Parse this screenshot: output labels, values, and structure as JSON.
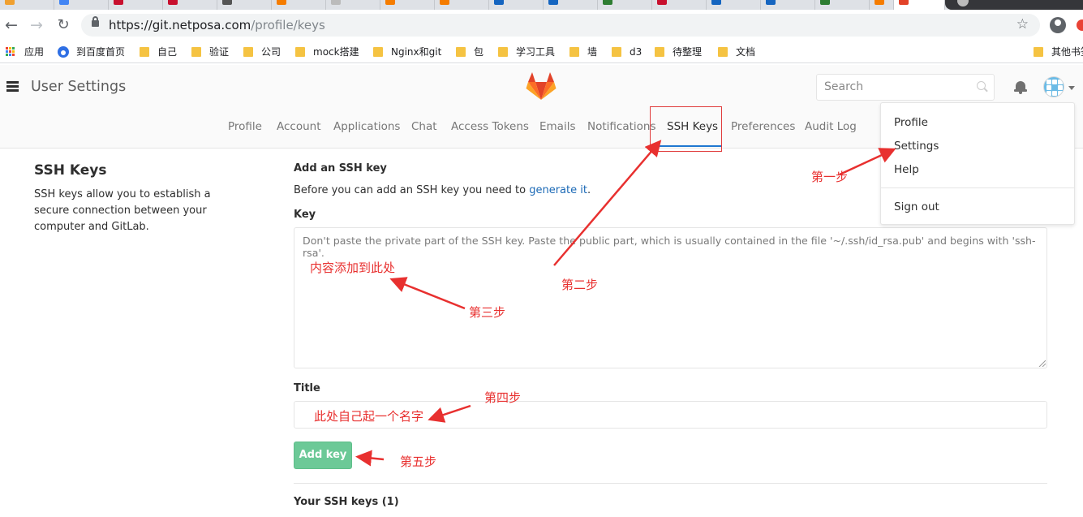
{
  "browser": {
    "url_host": "https://git.netposa.com",
    "url_path": "/profile/keys",
    "bookmarks": [
      "应用",
      "到百度首页",
      "自己",
      "验证",
      "公司",
      "mock搭建",
      "Nginx和git",
      "包",
      "学习工具",
      "墙",
      "d3",
      "待整理",
      "文档",
      "其他书签"
    ]
  },
  "header": {
    "title": "User Settings",
    "search_placeholder": "Search"
  },
  "nav": {
    "tabs": [
      "Profile",
      "Account",
      "Applications",
      "Chat",
      "Access Tokens",
      "Emails",
      "Notifications",
      "SSH Keys",
      "Preferences",
      "Audit Log"
    ],
    "active": "SSH Keys"
  },
  "sidebar": {
    "heading": "SSH Keys",
    "description": "SSH keys allow you to establish a secure connection between your computer and GitLab."
  },
  "form": {
    "section_title": "Add an SSH key",
    "intro_text": "Before you can add an SSH key you need to ",
    "intro_link": "generate it",
    "intro_end": ".",
    "key_label": "Key",
    "key_placeholder": "Don't paste the private part of the SSH key. Paste the public part, which is usually contained in the file '~/.ssh/id_rsa.pub' and begins with 'ssh-rsa'.",
    "title_label": "Title",
    "add_button": "Add key",
    "your_keys": "Your SSH keys (1)"
  },
  "dropdown": {
    "items": [
      "Profile",
      "Settings",
      "Help",
      "Sign out"
    ]
  },
  "annotations": {
    "step1": "第一步",
    "step2": "第二步",
    "step3": "第三步",
    "step4": "第四步",
    "step5": "第五步",
    "key_hint": "内容添加到此处",
    "title_hint": "此处自己起一个名字"
  },
  "colors": {
    "accent": "#1f78d1",
    "button": "#6cc997",
    "annotation": "#e8302f",
    "link": "#1b69b6"
  }
}
